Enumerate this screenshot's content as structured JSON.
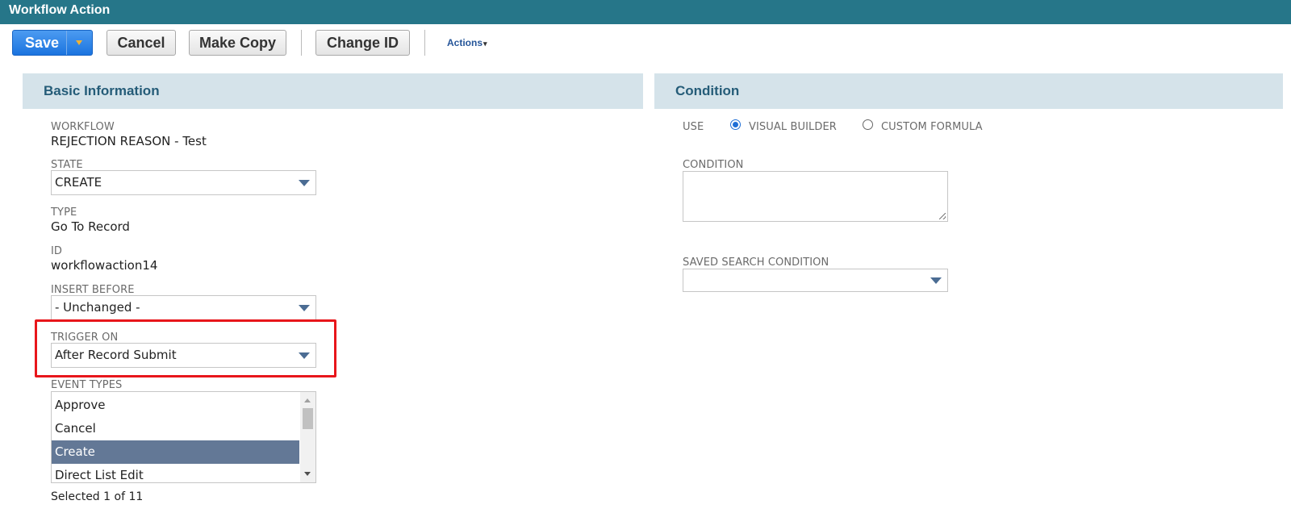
{
  "window": {
    "title": "Workflow Action"
  },
  "toolbar": {
    "save_label": "Save",
    "cancel_label": "Cancel",
    "make_copy_label": "Make Copy",
    "change_id_label": "Change ID",
    "actions_label": "Actions"
  },
  "basic": {
    "heading": "Basic Information",
    "workflow_label": "WORKFLOW",
    "workflow_value": "REJECTION REASON - Test",
    "state_label": "STATE",
    "state_value": "CREATE",
    "type_label": "TYPE",
    "type_value": "Go To Record",
    "id_label": "ID",
    "id_value": "workflowaction14",
    "insert_before_label": "INSERT BEFORE",
    "insert_before_value": "- Unchanged -",
    "trigger_on_label": "TRIGGER ON",
    "trigger_on_value": "After Record Submit",
    "event_types_label": "EVENT TYPES",
    "event_types": [
      "Approve",
      "Cancel",
      "Create",
      "Direct List Edit"
    ],
    "event_types_selected": "Create",
    "selected_count": "Selected 1 of 11"
  },
  "condition": {
    "heading": "Condition",
    "use_label": "USE",
    "visual_builder_label": "VISUAL BUILDER",
    "custom_formula_label": "CUSTOM FORMULA",
    "use_selected": "VISUAL BUILDER",
    "condition_label": "CONDITION",
    "condition_value": "",
    "saved_search_label": "SAVED SEARCH CONDITION",
    "saved_search_value": ""
  },
  "colors": {
    "titlebar": "#267689",
    "section_header": "#d5e3ea",
    "highlight_box": "#e8161b",
    "selected_item": "#637896",
    "save_button": "#1b74df"
  },
  "icons": {
    "save_menu": "dropdown-triangle-icon",
    "select_arrow": "chevron-down-icon",
    "actions_caret": "caret-icon"
  }
}
